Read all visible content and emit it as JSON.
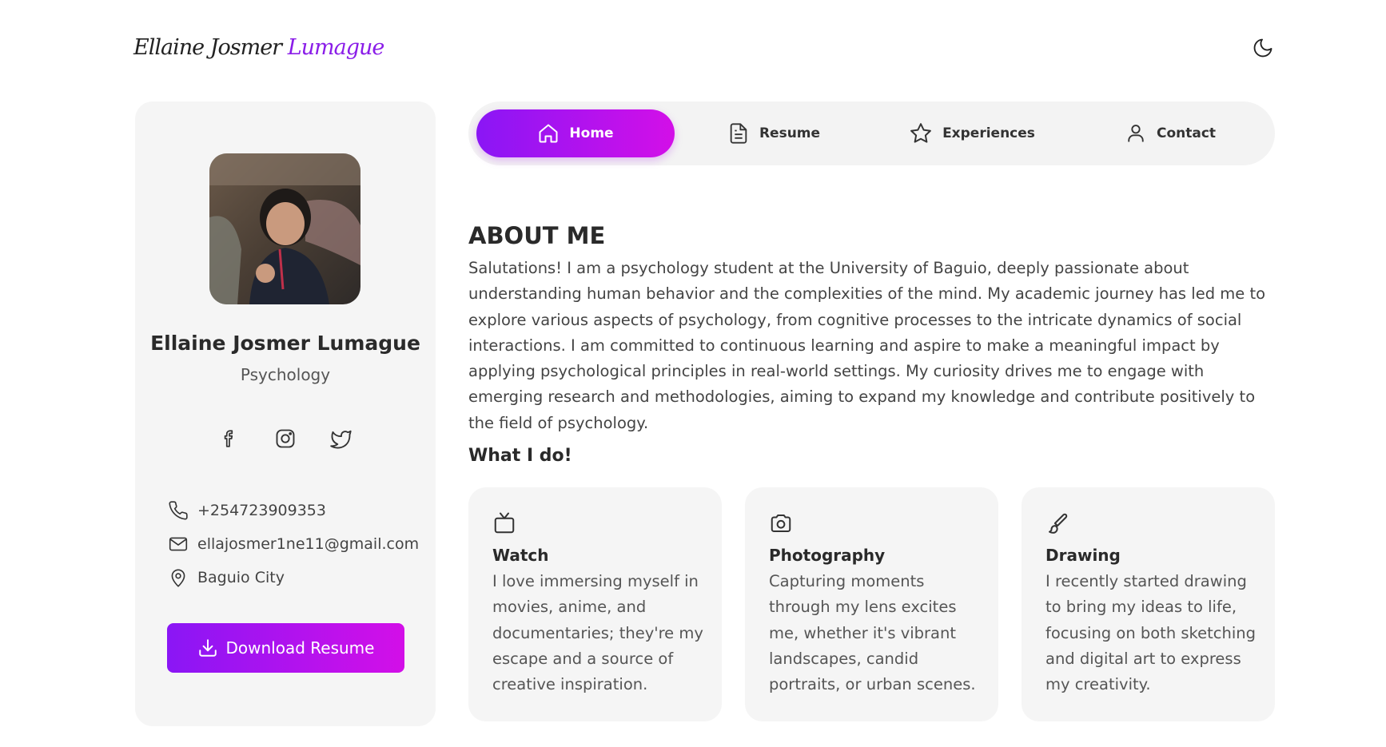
{
  "header": {
    "logo_first": "Ellaine Josmer",
    "logo_last": "Lumague"
  },
  "profile": {
    "name": "Ellaine Josmer Lumague",
    "role": "Psychology",
    "phone": "+254723909353",
    "email": "ellajosmer1ne11@gmail.com",
    "location": "Baguio City",
    "download_label": "Download Resume",
    "socials": [
      "facebook-icon",
      "instagram-icon",
      "twitter-icon"
    ]
  },
  "nav": {
    "items": [
      {
        "label": "Home",
        "icon": "home-icon",
        "active": true
      },
      {
        "label": "Resume",
        "icon": "document-icon",
        "active": false
      },
      {
        "label": "Experiences",
        "icon": "star-icon",
        "active": false
      },
      {
        "label": "Contact",
        "icon": "user-icon",
        "active": false
      }
    ]
  },
  "about": {
    "heading": "ABOUT ME",
    "text": "Salutations! I am a psychology student at the University of Baguio, deeply passionate about understanding human behavior and the complexities of the mind. My academic journey has led me to explore various aspects of psychology, from cognitive processes to the intricate dynamics of social interactions. I am committed to continuous learning and aspire to make a meaningful impact by applying psychological principles in real-world settings. My curiosity drives me to engage with emerging research and methodologies, aiming to expand my knowledge and contribute positively to the field of psychology."
  },
  "whatido": {
    "heading": "What I do!",
    "cards": [
      {
        "title": "Watch",
        "icon": "tv-icon",
        "desc": "I love immersing myself in movies, anime, and documentaries; they're my escape and a source of creative inspiration."
      },
      {
        "title": "Photography",
        "icon": "camera-icon",
        "desc": "Capturing moments through my lens excites me, whether it's vibrant landscapes, candid portraits, or urban scenes."
      },
      {
        "title": "Drawing",
        "icon": "brush-icon",
        "desc": "I recently started drawing to bring my ideas to life, focusing on both sketching and digital art to express my creativity."
      }
    ]
  },
  "colors": {
    "accent_start": "#8a16f5",
    "accent_end": "#d30fe8",
    "card_bg": "#f5f5f5"
  }
}
